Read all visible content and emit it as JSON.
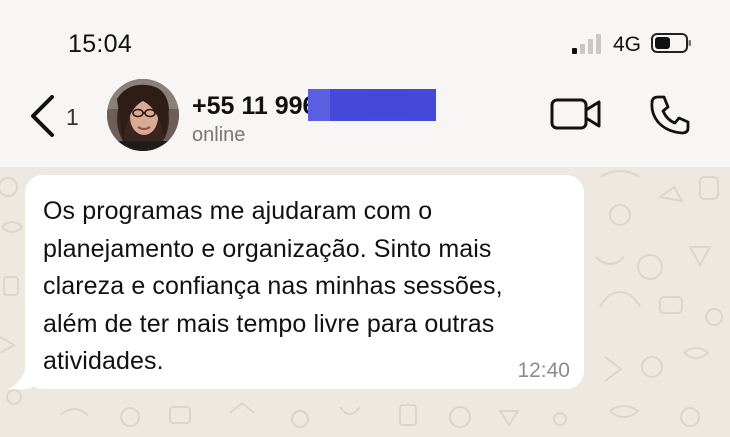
{
  "status_bar": {
    "time": "15:04",
    "network": "4G",
    "signal_bars_active": 1,
    "signal_bars_total": 4,
    "battery_level": 0.45
  },
  "header": {
    "back_count": "1",
    "contact_name_visible": "+55 11 996",
    "contact_status": "online",
    "icons": [
      "chevron-left-icon",
      "video-camera-icon",
      "phone-icon"
    ]
  },
  "message": {
    "text": "Os programas me ajudaram com o\nplanejamento e organização. Sinto mais\nclareza e confiança nas minhas sessões,\nalém de ter mais tempo livre para outras\natividades.",
    "time": "12:40"
  },
  "colors": {
    "redaction": "#3b3fd8",
    "chat_background": "#eee9e0",
    "bubble": "#ffffff",
    "header_background": "#f7f6f4"
  }
}
